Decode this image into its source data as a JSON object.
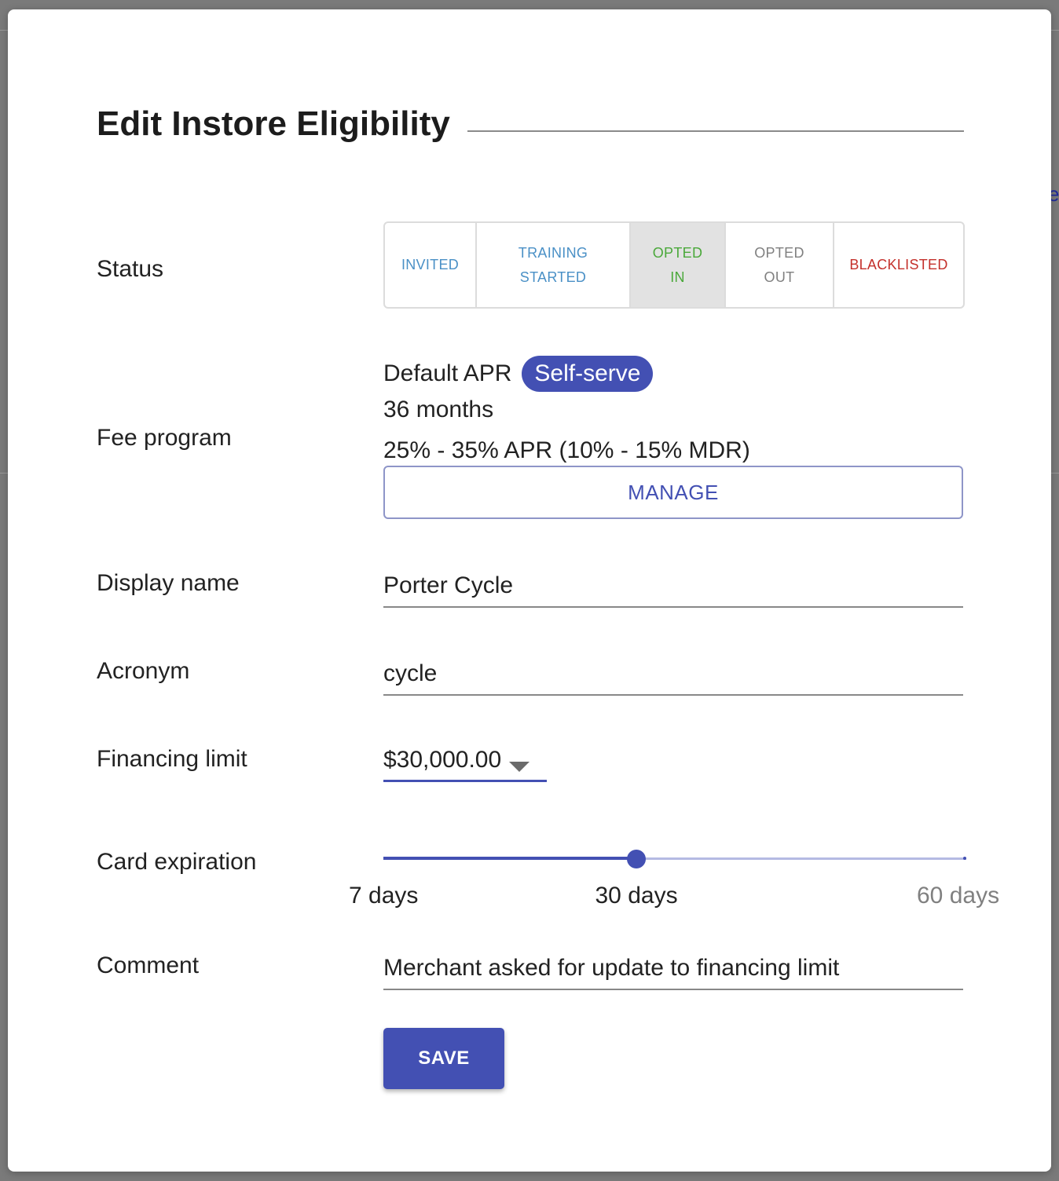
{
  "dialog": {
    "title": "Edit Instore Eligibility"
  },
  "status": {
    "label": "Status",
    "options": [
      {
        "line1": "INVITED",
        "line2": "",
        "color": "#4a90c6",
        "selected": false
      },
      {
        "line1": "TRAINING",
        "line2": "STARTED",
        "color": "#4a90c6",
        "selected": false
      },
      {
        "line1": "OPTED",
        "line2": "IN",
        "color": "#4aa83a",
        "selected": true
      },
      {
        "line1": "OPTED",
        "line2": "OUT",
        "color": "#808080",
        "selected": false
      },
      {
        "line1": "BLACKLISTED",
        "line2": "",
        "color": "#c4302b",
        "selected": false
      }
    ]
  },
  "fee_program": {
    "label": "Fee program",
    "name": "Default APR",
    "badge": "Self-serve",
    "term": "36 months",
    "rates": "25% - 35% APR (10% - 15% MDR)",
    "manage_label": "MANAGE"
  },
  "display_name": {
    "label": "Display name",
    "value": "Porter Cycle"
  },
  "acronym": {
    "label": "Acronym",
    "value": "cycle"
  },
  "financing_limit": {
    "label": "Financing limit",
    "value": "$30,000.00"
  },
  "card_expiration": {
    "label": "Card expiration",
    "min": 7,
    "max": 60,
    "value": 30,
    "ticks": [
      {
        "value": 7,
        "label": "7 days",
        "active": true
      },
      {
        "value": 30,
        "label": "30 days",
        "active": true
      },
      {
        "value": 60,
        "label": "60 days",
        "active": false
      }
    ]
  },
  "comment": {
    "label": "Comment",
    "value": "Merchant asked for update to financing limit"
  },
  "actions": {
    "save_label": "SAVE"
  },
  "colors": {
    "primary": "#4350b3",
    "primary_light": "#b5bae3"
  }
}
